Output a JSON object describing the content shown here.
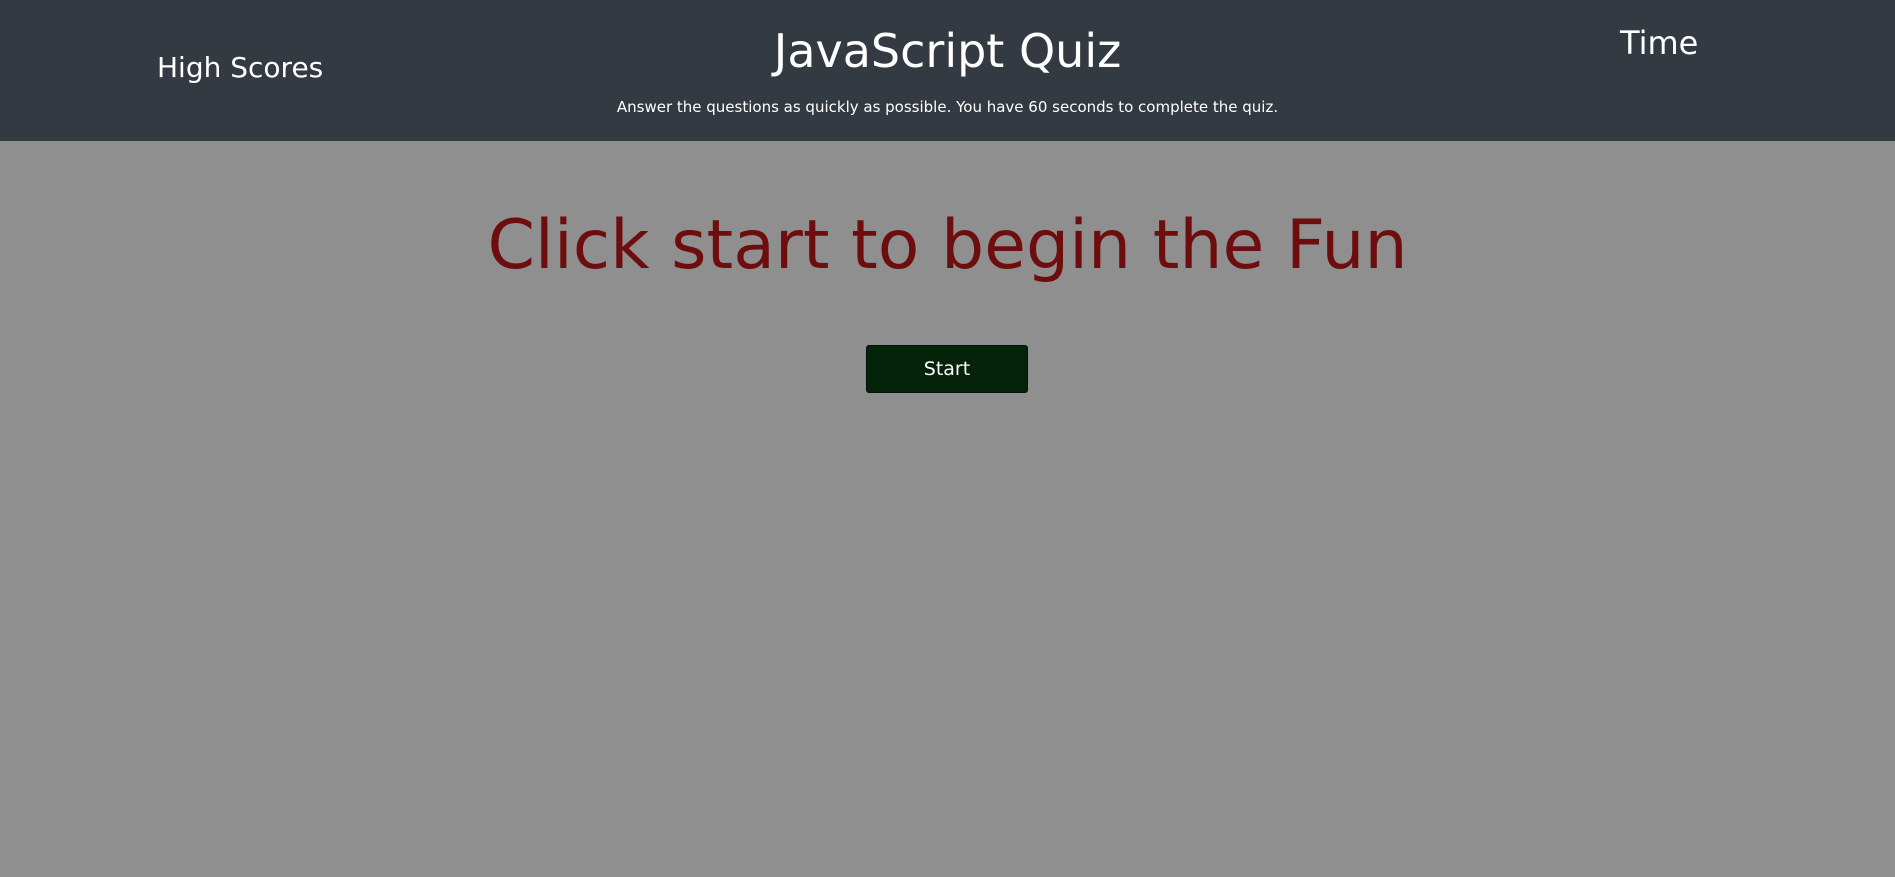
{
  "header": {
    "high_scores_label": "High Scores",
    "title": "JavaScript Quiz",
    "subtitle": "Answer the questions as quickly as possible. You have 60 seconds to complete the quiz.",
    "time_label": "Time"
  },
  "main": {
    "headline": "Click start to begin the Fun",
    "start_button_label": "Start"
  },
  "colors": {
    "header_bg": "#343a42",
    "page_bg": "#8f8f8f",
    "headline_text": "#6e0d0d",
    "start_button_bg": "#052308",
    "header_text": "#ffffff"
  }
}
